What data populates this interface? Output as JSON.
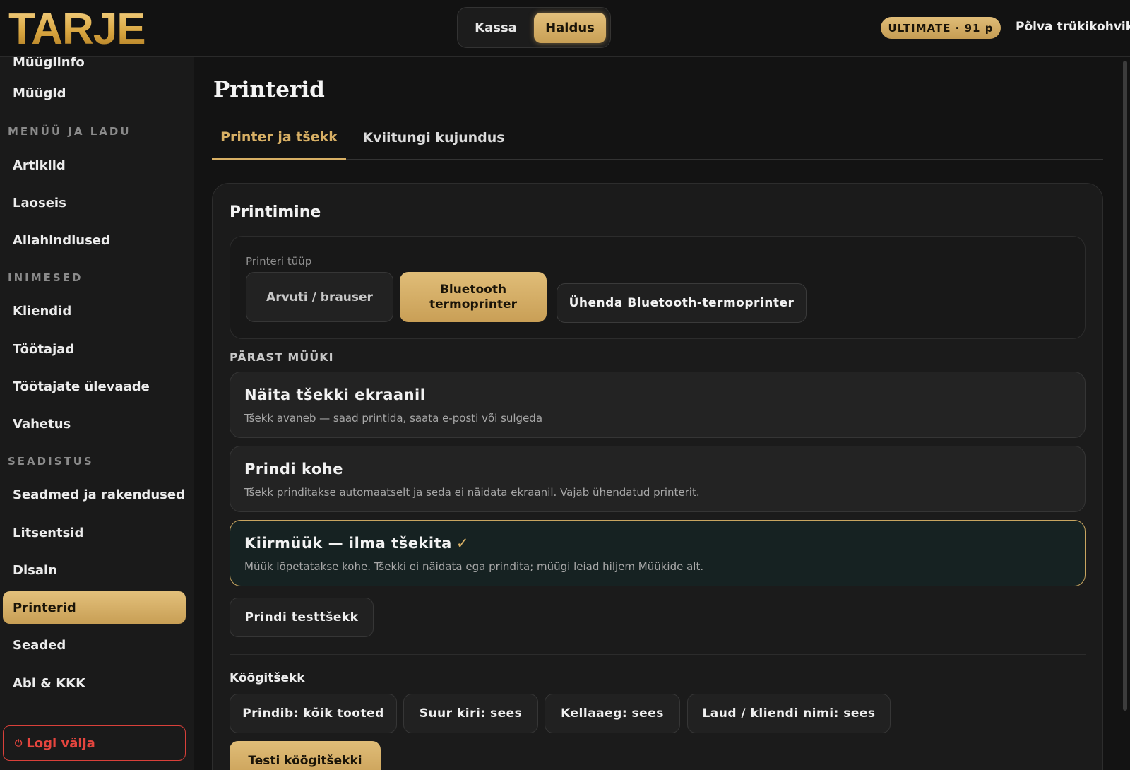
{
  "app": {
    "logo_text": "TARJE",
    "accent_color": "#d8b065",
    "danger_color": "#e5453e"
  },
  "header": {
    "modes": [
      {
        "label": "Kassa",
        "active": false
      },
      {
        "label": "Haldus",
        "active": true
      }
    ],
    "plan_badge": "ULTIMATE · 91 p",
    "store_name": "Põlva trükikohvik"
  },
  "sidebar": {
    "cut_item": "Müügiinfo",
    "items_top": [
      {
        "label": "Müügid"
      }
    ],
    "sections": [
      {
        "title": "MENÜÜ JA LADU",
        "items": [
          "Artiklid",
          "Laoseis",
          "Allahindlused"
        ]
      },
      {
        "title": "INIMESED",
        "items": [
          "Kliendid",
          "Töötajad",
          "Töötajate ülevaade",
          "Vahetus"
        ]
      },
      {
        "title": "SEADISTUS",
        "items": [
          "Seadmed ja rakendused",
          "Litsentsid",
          "Disain",
          "Printerid",
          "Seaded",
          "Abi & KKK"
        ]
      }
    ],
    "active_item": "Printerid",
    "logout_label": "Logi välja",
    "logout_icon": "power-icon"
  },
  "main": {
    "title": "Printerid",
    "tabs": [
      {
        "label": "Printer ja tšekk",
        "active": true
      },
      {
        "label": "Kviitungi kujundus",
        "active": false
      }
    ],
    "card": {
      "title": "Printimine",
      "printer_type": {
        "label": "Printeri tüüp",
        "options": [
          {
            "label": "Arvuti / brauser",
            "selected": false
          },
          {
            "label": "Bluetooth termoprinter",
            "selected": true
          }
        ],
        "connect_label": "Ühenda Bluetooth-termoprinter"
      },
      "after_sale": {
        "label": "PÄRAST MÜÜKI",
        "options": [
          {
            "title": "Näita tšekki ekraanil",
            "desc": "Tšekk avaneb — saad printida, saata e-posti või sulgeda",
            "selected": false
          },
          {
            "title": "Prindi kohe",
            "desc": "Tšekk prinditakse automaatselt ja seda ei näidata ekraanil. Vajab ühendatud printerit.",
            "selected": false
          },
          {
            "title": "Kiirmüük — ilma tšekita",
            "desc": "Müük lõpetatakse kohe. Tšekki ei näidata ega prindita; müügi leiad hiljem Müükide alt.",
            "selected": true
          }
        ],
        "check_mark": "✓"
      },
      "test_print_label": "Prindi testtšekk",
      "kitchen": {
        "label": "Köögitšekk",
        "toggles": [
          "Prindib: kõik tooted",
          "Suur kiri: sees",
          "Kellaaeg: sees",
          "Laud / kliendi nimi: sees"
        ],
        "test_label": "Testi köögitšekki"
      }
    }
  }
}
